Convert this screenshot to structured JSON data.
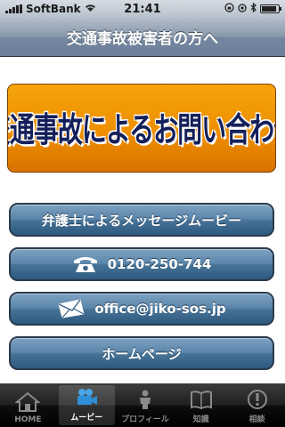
{
  "status_bar": {
    "carrier": "SoftBank",
    "time": "21:41",
    "battery_level": 0.9
  },
  "nav": {
    "title": "交通事故被害者の方へ"
  },
  "banner": {
    "text": "交通事故によるお問い合わせ"
  },
  "buttons": {
    "message": "弁護士によるメッセージムービー",
    "phone": "0120-250-744",
    "email": "office@jiko-sos.jp",
    "homepage": "ホームページ"
  },
  "tabs": [
    {
      "label": "HOME",
      "icon": "house-icon",
      "selected": false
    },
    {
      "label": "ムービー",
      "icon": "video-camera-icon",
      "selected": true
    },
    {
      "label": "プロフィール",
      "icon": "person-icon",
      "selected": false
    },
    {
      "label": "知識",
      "icon": "book-icon",
      "selected": false
    },
    {
      "label": "相談",
      "icon": "exclamation-icon",
      "selected": false
    }
  ],
  "colors": {
    "banner_orange": "#ee8f00",
    "banner_text": "#14205a",
    "button_blue": "#477397",
    "nav_blue": "#7587a0"
  }
}
